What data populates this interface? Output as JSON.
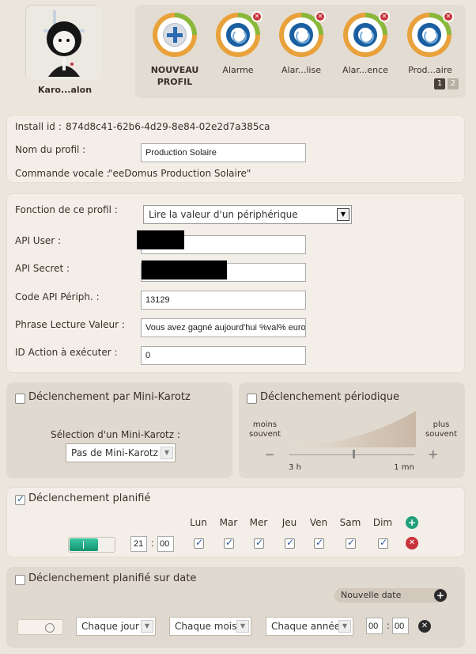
{
  "user": {
    "name": "Karo...alon"
  },
  "profiles": [
    {
      "label": "NOUVEAU\nPROFIL",
      "line1": "NOUVEAU",
      "line2": "PROFIL",
      "is_new": true
    },
    {
      "label": "Alarme"
    },
    {
      "label": "Alar...lise"
    },
    {
      "label": "Alar...ence"
    },
    {
      "label": "Prod...aire"
    }
  ],
  "pagination": {
    "pages": [
      "1",
      "2"
    ],
    "current": "1"
  },
  "info": {
    "install_id_label": "Install id :",
    "install_id": "874d8c41-62b6-4d29-8e84-02e2d7a385ca",
    "nom_label": "Nom du profil :",
    "nom_value": "Production Solaire",
    "commande_label": "Commande vocale :",
    "commande_value": "\"eeDomus Production Solaire\""
  },
  "config": {
    "fonction_label": "Fonction de ce profil :",
    "fonction_value": "Lire la valeur d'un périphérique",
    "api_user_label": "API User :",
    "api_secret_label": "API Secret :",
    "code_label": "Code API Périph. :",
    "code_value": "13129",
    "phrase_label": "Phrase Lecture Valeur :",
    "phrase_value": "Vous avez gagné aujourd'hui %val% euro",
    "action_label": "ID Action à exécuter :",
    "action_value": "0"
  },
  "mini_karotz": {
    "title": "Déclenchement par Mini-Karotz",
    "checked": false,
    "select_label": "Sélection d'un Mini-Karotz :",
    "select_value": "Pas de Mini-Karotz"
  },
  "periodique": {
    "title": "Déclenchement périodique",
    "checked": false,
    "left_label_1": "moins",
    "left_label_2": "souvent",
    "right_label_1": "plus",
    "right_label_2": "souvent",
    "min_tick": "3 h",
    "max_tick": "1 mn",
    "minus": "−",
    "plus": "+"
  },
  "planifie": {
    "title": "Déclenchement planifié",
    "checked": true,
    "days": [
      "Lun",
      "Mar",
      "Mer",
      "Jeu",
      "Ven",
      "Sam",
      "Dim"
    ],
    "hour": "21",
    "minute": "00",
    "sep": ":"
  },
  "planifie_date": {
    "title": "Déclenchement planifié sur date",
    "checked": false,
    "nouvelle_date": "Nouvelle date",
    "jour": "Chaque jour",
    "mois": "Chaque mois",
    "annee": "Chaque année",
    "hour": "00",
    "minute": "00",
    "sep": ":"
  },
  "colors": {
    "accent_green": "#1fa07a",
    "ring_orange": "#e9a23b",
    "ring_green": "#8ab83a",
    "ring_blue": "#1a5fa0",
    "close_red": "#c8323a"
  }
}
